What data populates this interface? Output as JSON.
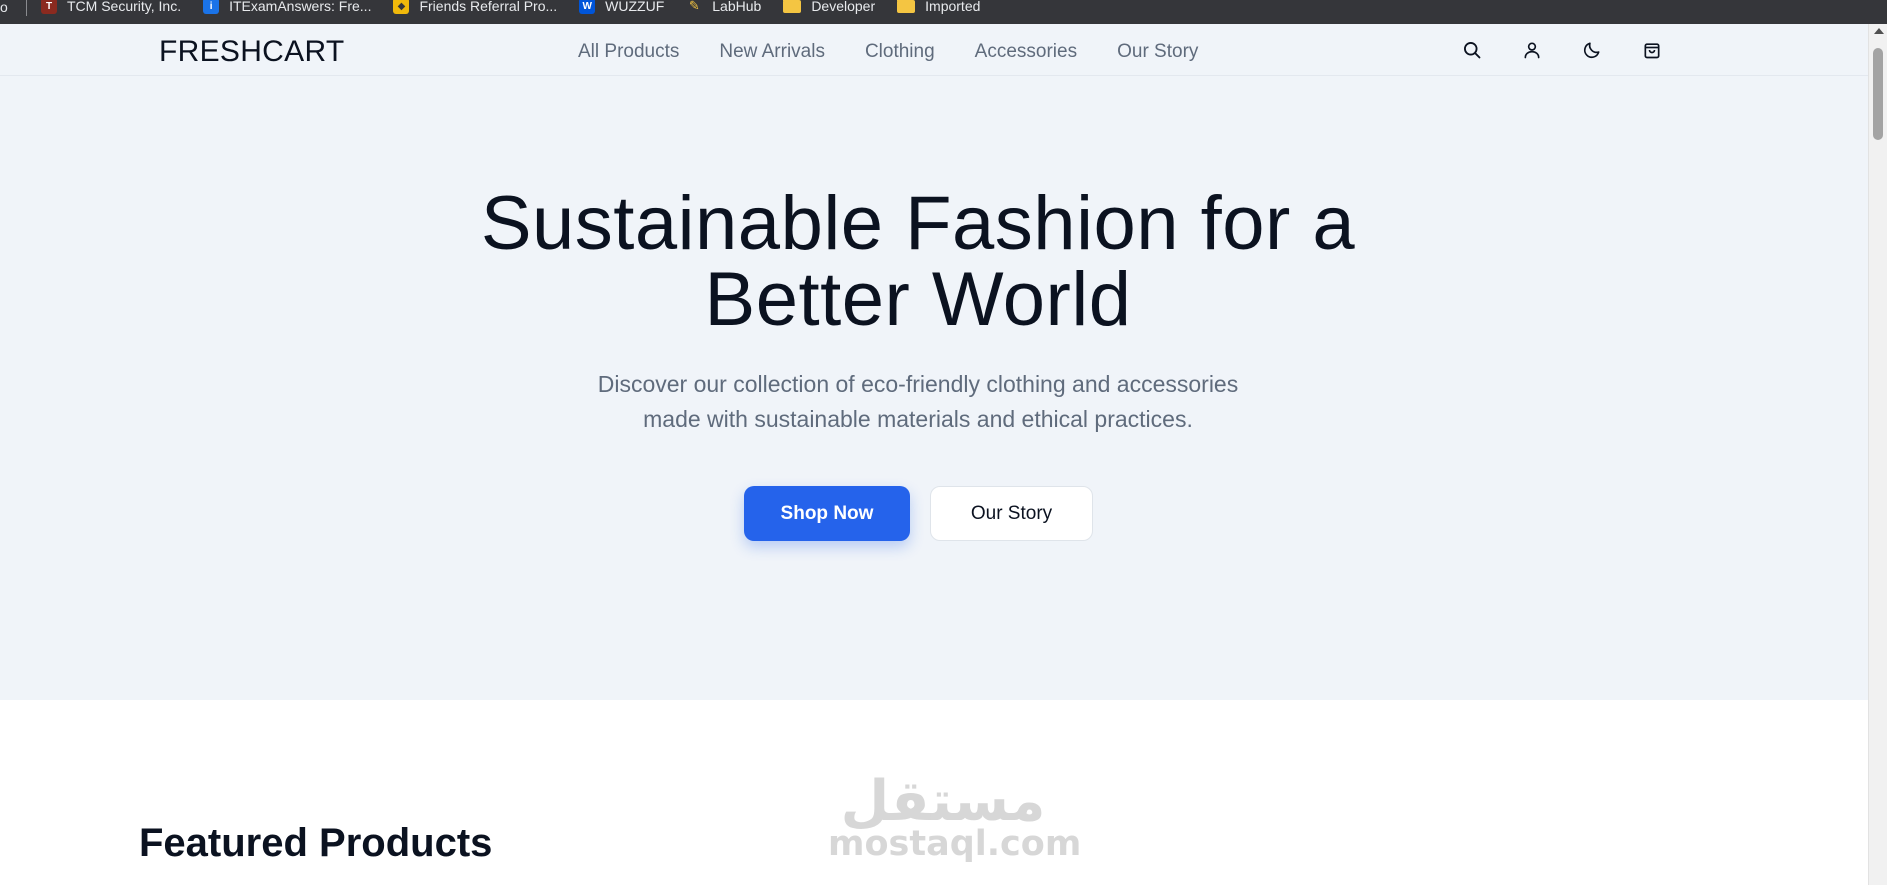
{
  "browser": {
    "bookmarks": [
      {
        "label": "TCM Security, Inc.",
        "icon": "tcm-icon",
        "color": "#c0392b"
      },
      {
        "label": "ITExamAnswers: Fre...",
        "icon": "itexam-icon",
        "color": "#1a73e8"
      },
      {
        "label": "Friends Referral Pro...",
        "icon": "binance-icon",
        "color": "#f0b90b"
      },
      {
        "label": "WUZZUF",
        "icon": "wuzzuf-icon",
        "color": "#0055d9"
      },
      {
        "label": "LabHub",
        "icon": "labhub-icon",
        "color": "#f4c542"
      },
      {
        "label": "Developer",
        "icon": "folder-icon",
        "color": "#f4c542"
      },
      {
        "label": "Imported",
        "icon": "folder-icon",
        "color": "#f4c542"
      }
    ]
  },
  "header": {
    "logo": "FRESHCART",
    "nav": [
      "All Products",
      "New Arrivals",
      "Clothing",
      "Accessories",
      "Our Story"
    ],
    "icons": [
      "search-icon",
      "user-icon",
      "moon-icon",
      "shopping-bag-icon"
    ]
  },
  "hero": {
    "title_line1": "Sustainable Fashion for a",
    "title_line2": "Better World",
    "subtitle_line1": "Discover our collection of eco-friendly clothing and accessories",
    "subtitle_line2": "made with sustainable materials and ethical practices.",
    "primary_button": "Shop Now",
    "secondary_button": "Our Story"
  },
  "featured": {
    "heading": "Featured Products"
  },
  "watermark": {
    "arabic": "مستقل",
    "latin": "mostaql.com"
  },
  "colors": {
    "accent": "#2563eb",
    "hero_bg": "#f0f4f9",
    "text": "#0b1220",
    "muted": "#5f6b7c"
  }
}
